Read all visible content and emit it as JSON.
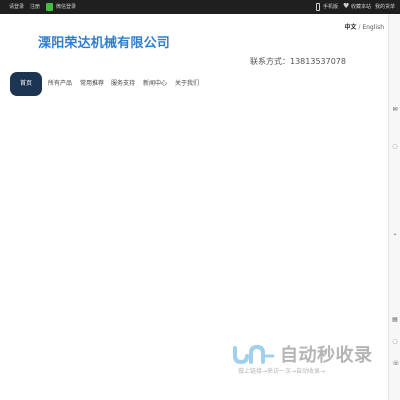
{
  "topbar": {
    "login": "请登录",
    "register": "注册",
    "wechat_login": "微信登录",
    "mobile": "手机版",
    "favorite": "收藏本站",
    "my_order": "我的货单"
  },
  "language": {
    "chinese": "中文",
    "separator": "/",
    "english": "English"
  },
  "header": {
    "company_name": "溧阳荣达机械有限公司",
    "contact": "联系方式：13813537078"
  },
  "nav": {
    "items": [
      "首页",
      "所有产品",
      "常用推荐",
      "服务支持",
      "新闻中心",
      "关于我们"
    ],
    "active_color": "#1c3552"
  },
  "sidebar": {
    "icons": [
      "mail-icon",
      "chat-icon",
      "chevron-up-icon",
      "note-icon",
      "chat-bottom-icon",
      "phone-bottom-icon"
    ]
  },
  "watermark": {
    "title": "自动秒收录",
    "subtitle": "做上链接→来访一次→自动收录→"
  },
  "colors": {
    "topbar_bg": "#1f1f1f",
    "brand_blue": "#2f7fd1",
    "nav_active": "#1c3552"
  }
}
